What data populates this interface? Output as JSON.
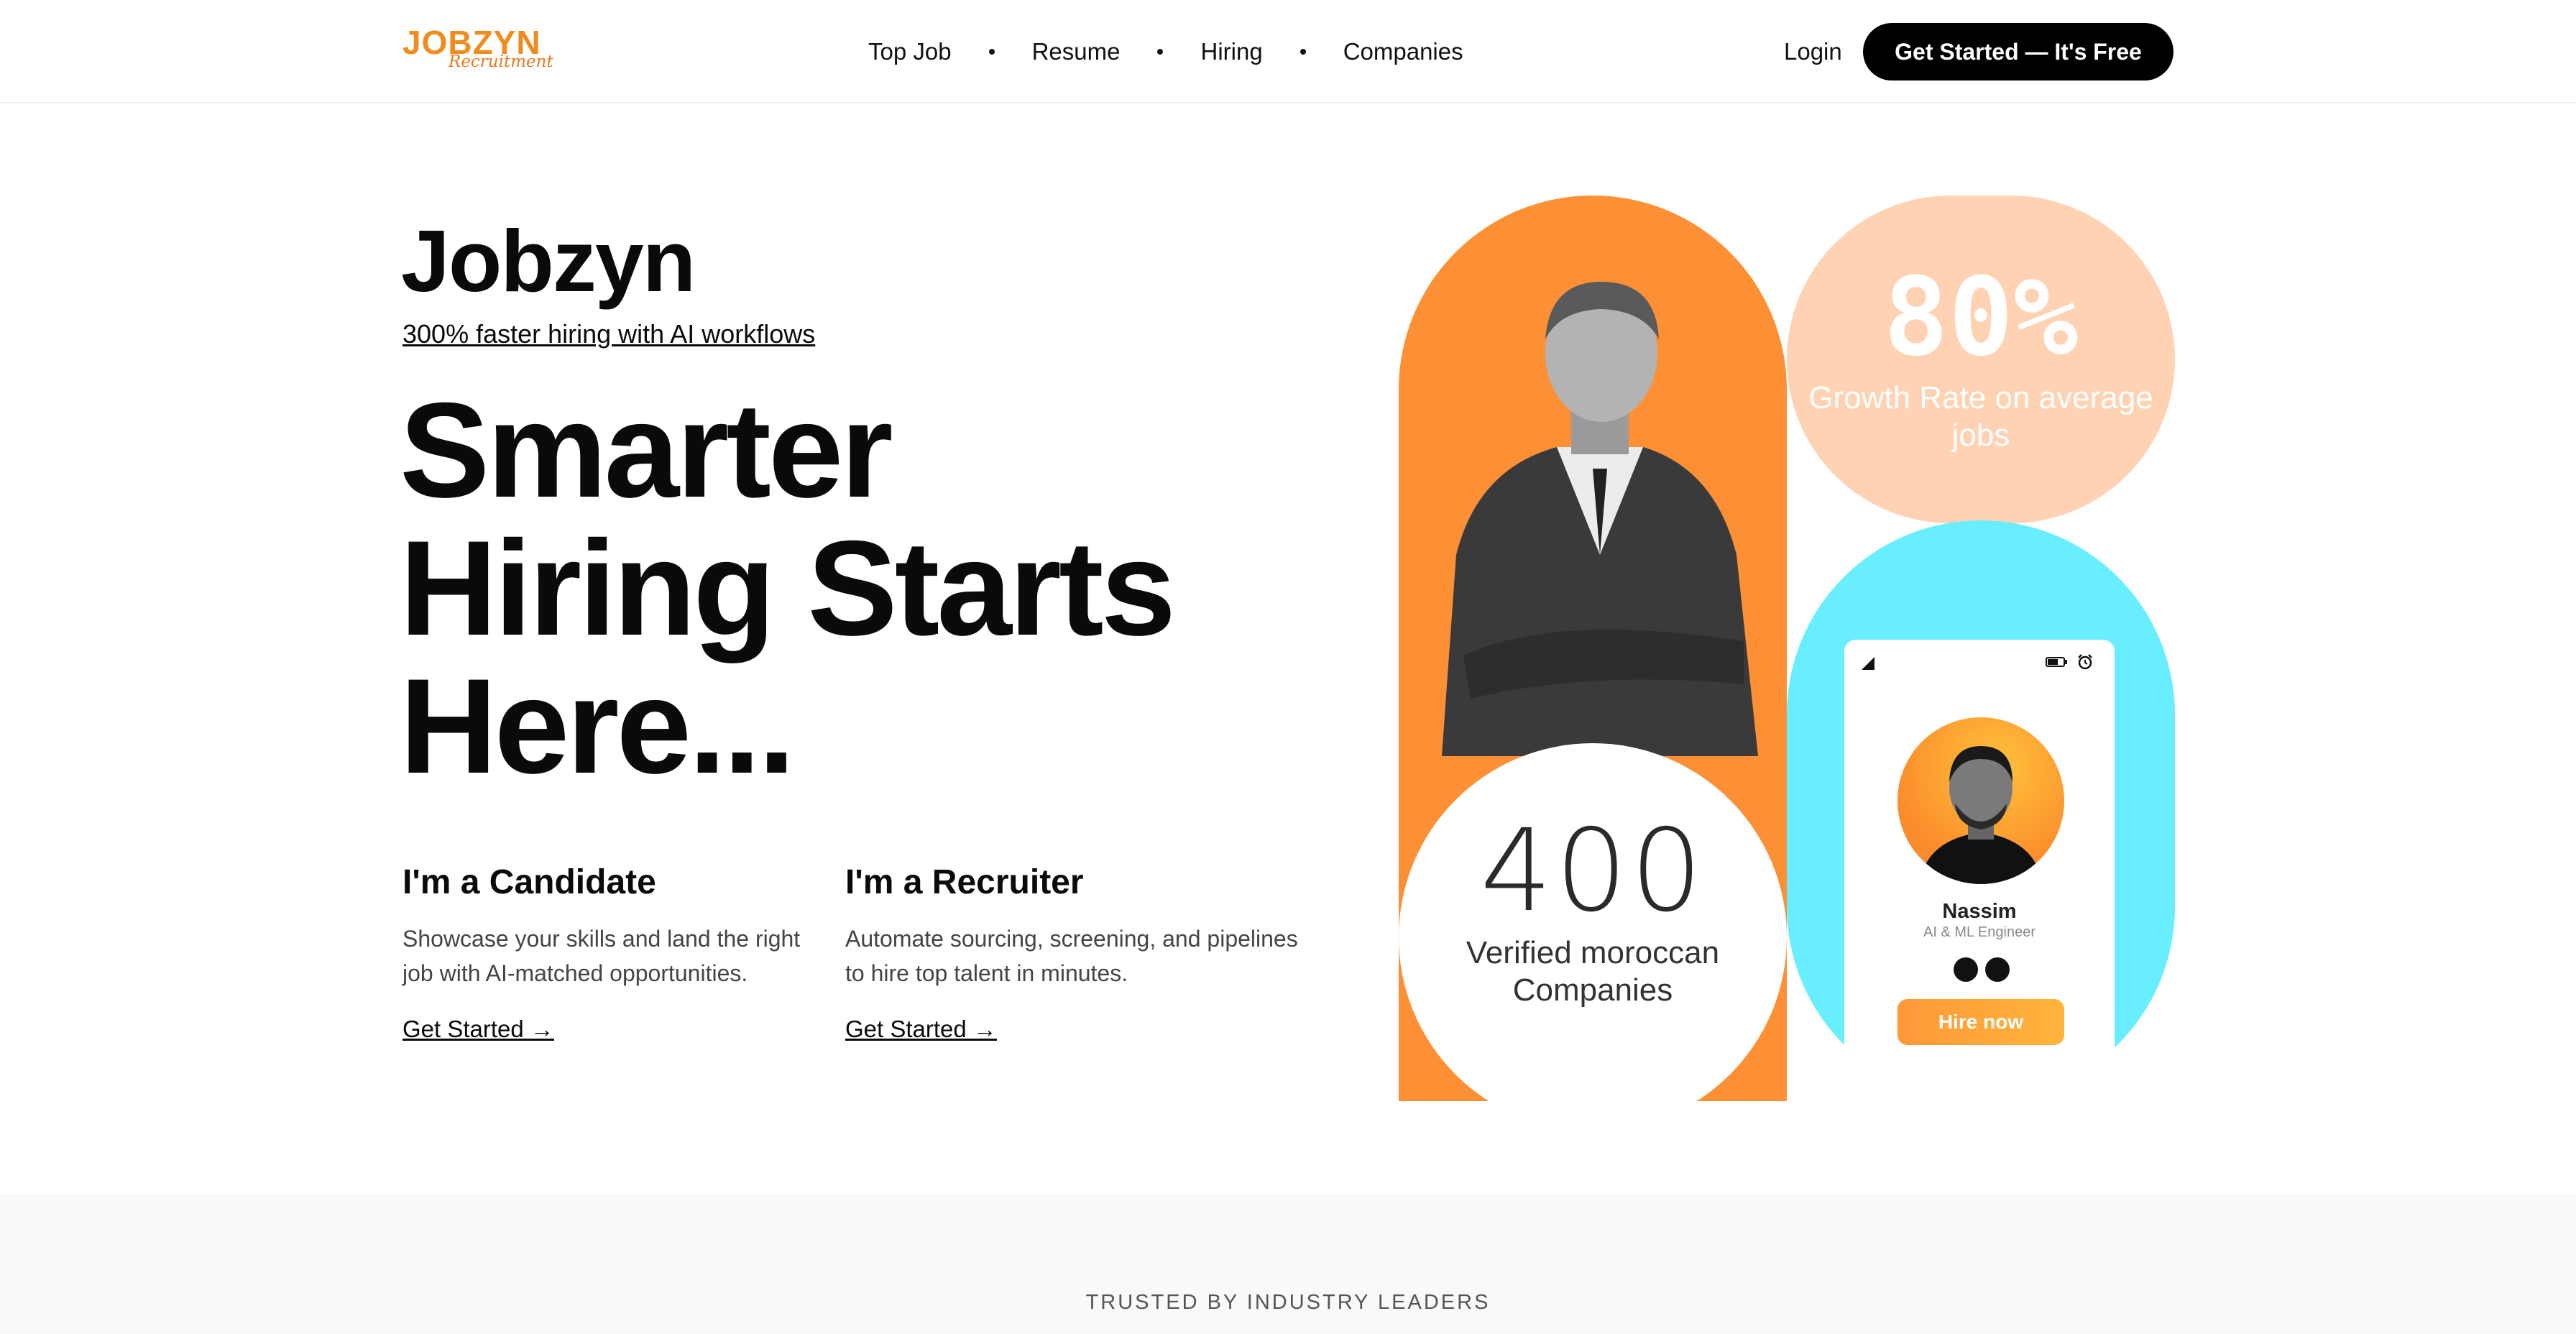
{
  "nav": {
    "logo": {
      "main": "JOBZYN",
      "sub": "Recruitment"
    },
    "links": [
      "Top Job",
      "Resume",
      "Hiring",
      "Companies"
    ],
    "login": "Login",
    "cta": "Get Started — It's Free"
  },
  "hero": {
    "brand": "Jobzyn",
    "tagline": "300% faster hiring with AI workflows",
    "headline": [
      "Smarter",
      "Hiring Starts",
      "Here..."
    ],
    "candidate": {
      "title": "I'm a Candidate",
      "text": "Showcase your skills and land the right job with AI-matched opportunities.",
      "link": "Get Started →"
    },
    "recruiter": {
      "title": "I'm a Recruiter",
      "text": "Automate sourcing, screening, and pipelines to hire top talent in minutes.",
      "link": "Get Started →"
    }
  },
  "stats": {
    "growth": {
      "value": "80%",
      "label": "Growth Rate on average jobs"
    },
    "companies": {
      "value": "400",
      "label": "Verified moroccan Companies"
    }
  },
  "profile_card": {
    "name": "Nassim",
    "role": "AI & ML Engineer",
    "button": "Hire now"
  },
  "trusted": {
    "label": "TRUSTED BY INDUSTRY LEADERS"
  },
  "colors": {
    "orange": "#fd8f35",
    "peach": "#ffd2b3",
    "cyan": "#68eefe",
    "black": "#000000"
  }
}
